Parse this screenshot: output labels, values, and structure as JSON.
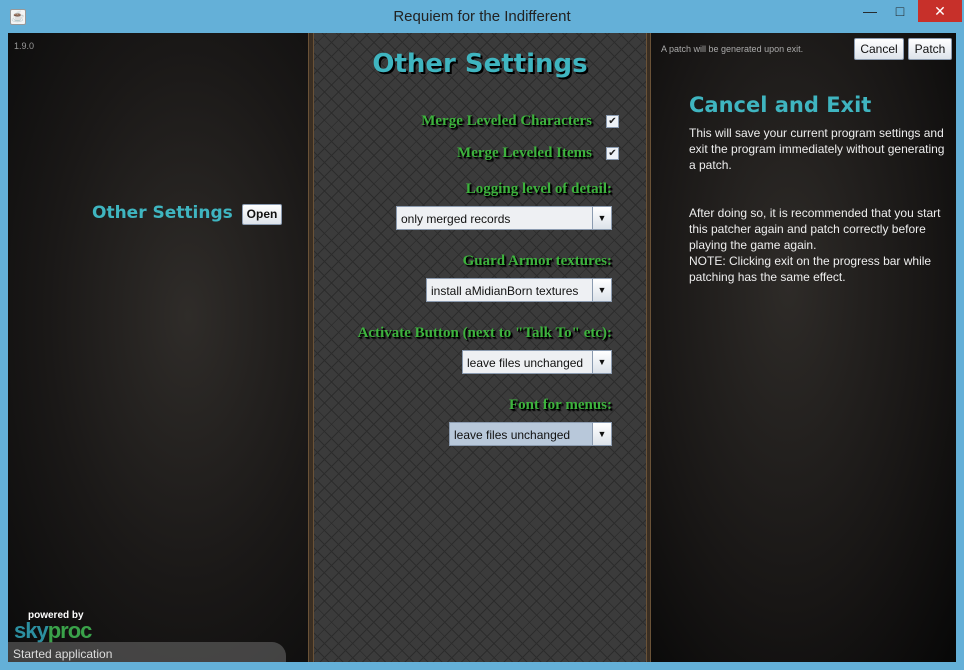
{
  "window": {
    "title": "Requiem for the Indifferent",
    "minimize": "—",
    "maximize": "□",
    "close": "✕"
  },
  "left": {
    "version": "1.9.0",
    "section_title": "Other Settings",
    "open_label": "Open",
    "logo": {
      "powered_by": "powered by",
      "sky": "sky",
      "proc": "proc"
    },
    "status": "Started application"
  },
  "middle": {
    "title": "Other Settings",
    "merge_characters": {
      "label": "Merge Leveled Characters",
      "checked": true
    },
    "merge_items": {
      "label": "Merge Leveled Items",
      "checked": true
    },
    "logging": {
      "label": "Logging level of detail:",
      "value": "only merged records"
    },
    "guard": {
      "label": "Guard Armor textures:",
      "value": "install aMidianBorn textures"
    },
    "activate": {
      "label": "Activate Button (next to \"Talk To\" etc):",
      "value": "leave files unchanged"
    },
    "font": {
      "label": "Font for menus:",
      "value": "leave files unchanged"
    }
  },
  "right": {
    "hint": "A patch will be generated upon exit.",
    "cancel_label": "Cancel",
    "patch_label": "Patch",
    "title": "Cancel and Exit",
    "p1": "This will save your current program settings and exit the program immediately without generating a patch.",
    "p2": "After doing so, it is recommended that you start this patcher again and patch correctly before playing the game again.",
    "p3": "NOTE: Clicking exit on the progress bar while patching has the same effect."
  },
  "colors": {
    "accent": "#3fb5c0",
    "label_green": "#3db33d",
    "frame": "#64b0d8"
  }
}
